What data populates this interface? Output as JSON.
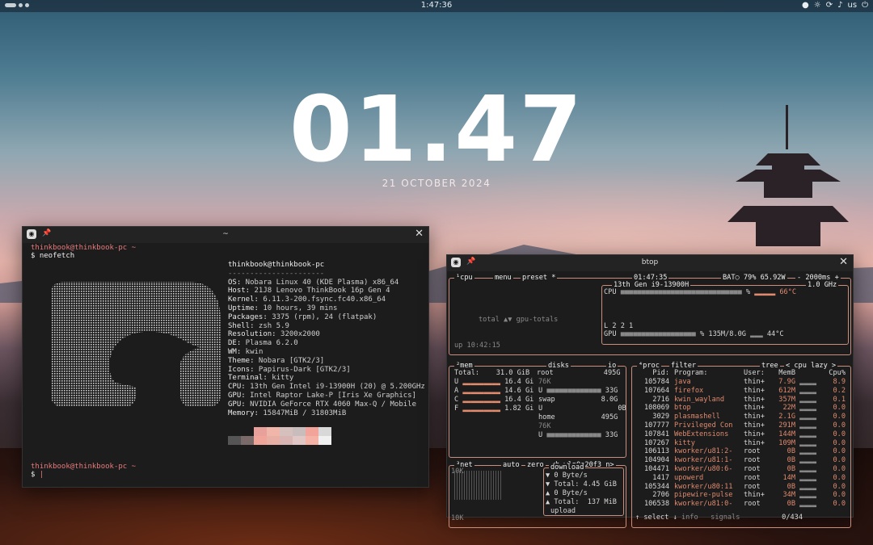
{
  "topbar": {
    "time": "1:47:36",
    "layout": "us"
  },
  "lockclock": {
    "time": "01.47",
    "date": "21 OCTOBER 2024"
  },
  "kitty": {
    "title": "~",
    "prompt1": "thinkbook@thinkbook-pc ~",
    "cmd": "$ neofetch",
    "prompt2": "thinkbook@thinkbook-pc ~",
    "cursor": "$ ",
    "header": "thinkbook@thinkbook-pc",
    "sep": "----------------------",
    "info": [
      {
        "k": "OS:",
        "v": " Nobara Linux 40 (KDE Plasma) x86_64"
      },
      {
        "k": "Host:",
        "v": " 21J8 Lenovo ThinkBook 16p Gen 4"
      },
      {
        "k": "Kernel:",
        "v": " 6.11.3-200.fsync.fc40.x86_64"
      },
      {
        "k": "Uptime:",
        "v": " 10 hours, 39 mins"
      },
      {
        "k": "Packages:",
        "v": " 3375 (rpm), 24 (flatpak)"
      },
      {
        "k": "Shell:",
        "v": " zsh 5.9"
      },
      {
        "k": "Resolution:",
        "v": " 3200x2000"
      },
      {
        "k": "DE:",
        "v": " Plasma 6.2.0"
      },
      {
        "k": "WM:",
        "v": " kwin"
      },
      {
        "k": "Theme:",
        "v": " Nobara [GTK2/3]"
      },
      {
        "k": "Icons:",
        "v": " Papirus-Dark [GTK2/3]"
      },
      {
        "k": "Terminal:",
        "v": " kitty"
      },
      {
        "k": "CPU:",
        "v": " 13th Gen Intel i9-13900H (20) @ 5.200GHz"
      },
      {
        "k": "GPU:",
        "v": " Intel Raptor Lake-P [Iris Xe Graphics]"
      },
      {
        "k": "GPU:",
        "v": " NVIDIA GeForce RTX 4060 Max-Q / Mobile"
      },
      {
        "k": "Memory:",
        "v": " 15847MiB / 31803MiB"
      }
    ],
    "palette_top": [
      "#1c1c1c",
      "#1c1c1c",
      "#e8a09a",
      "#f0b6a9",
      "#d6c0be",
      "#c9bcbc",
      "#f2a49a",
      "#d8d8d8"
    ],
    "palette_bot": [
      "#555",
      "#7a6a6a",
      "#f0a59a",
      "#e8b0a5",
      "#d8b5b2",
      "#e0c6c4",
      "#f5b3a8",
      "#f0f0f0"
    ]
  },
  "btop": {
    "title": "btop",
    "cpu_label": "¹cpu",
    "menu": "menu",
    "preset": "preset *",
    "clock": "01:47:35",
    "bat": "BAT○ 79% 65.92W",
    "rate": "- 2000ms +",
    "cpu_model": "13th Gen i9-13900H",
    "freq": "1.0 GHz",
    "cpu_row": "CPU",
    "cpu_pct": "%",
    "cpu_temp": "66°C",
    "load": "L 2 2 1",
    "gpu_row": "GPU",
    "gpu_pct": "%",
    "gpu_mem": "135M/8.0G",
    "gpu_temp": "44°C",
    "totals": "total ▲▼ gpu-totals",
    "uptime": "up 10:42:15",
    "mem": {
      "label": "²mem",
      "disks": "disks",
      "io": "io",
      "total": "Total:    31.0 GiB",
      "rows": [
        {
          "k": "U",
          "v": "16.4 Gi"
        },
        {
          "k": "A",
          "v": "14.6 Gi"
        },
        {
          "k": "C",
          "v": "16.4 Gi"
        },
        {
          "k": "F",
          "v": "1.82 Gi"
        }
      ],
      "root": "root",
      "root_size": "495G",
      "root_pct": "76K",
      "root_u": "U",
      "root_used": "33G",
      "swap": "swap",
      "swap_size": "8.0G",
      "swap_u": "U",
      "swap_used": "0B",
      "home": "home",
      "home_size": "495G",
      "home_pct": "76K",
      "home_u": "U",
      "home_used": "33G"
    },
    "net": {
      "label": "³net",
      "auto": "auto",
      "zero": "zero",
      "iface": "<b wlp0s20f3 n>",
      "scale_top": "10K",
      "scale_bot": "10K",
      "download": "download",
      "dl_rate": "▼ 0 Byte/s",
      "dl_total": "▼ Total: 4.45 GiB",
      "ul_rate": "▲ 0 Byte/s",
      "ul_total": "▲ Total:  137 MiB",
      "upload": "upload"
    },
    "proc": {
      "label": "⁴proc",
      "filter": "filter",
      "tree": "tree",
      "sort": "< cpu lazy >",
      "headers": {
        "pid": "Pid:",
        "prog": "Program:",
        "user": "User:",
        "mem": "MemB",
        "cpu": "Cpu%"
      },
      "rows": [
        {
          "pid": "105784",
          "prog": "java",
          "user": "thin+",
          "mem": "7.9G",
          "cpu": "8.9"
        },
        {
          "pid": "107664",
          "prog": "firefox",
          "user": "thin+",
          "mem": "612M",
          "cpu": "0.2"
        },
        {
          "pid": "2716",
          "prog": "kwin_wayland",
          "user": "thin+",
          "mem": "357M",
          "cpu": "0.1"
        },
        {
          "pid": "108069",
          "prog": "btop",
          "user": "thin+",
          "mem": "22M",
          "cpu": "0.0"
        },
        {
          "pid": "3029",
          "prog": "plasmashell",
          "user": "thin+",
          "mem": "2.1G",
          "cpu": "0.0"
        },
        {
          "pid": "107777",
          "prog": "Privileged Con",
          "user": "thin+",
          "mem": "291M",
          "cpu": "0.0"
        },
        {
          "pid": "107841",
          "prog": "WebExtensions",
          "user": "thin+",
          "mem": "144M",
          "cpu": "0.0"
        },
        {
          "pid": "107267",
          "prog": "kitty",
          "user": "thin+",
          "mem": "109M",
          "cpu": "0.0"
        },
        {
          "pid": "106113",
          "prog": "kworker/u81:2-",
          "user": "root",
          "mem": "0B",
          "cpu": "0.0"
        },
        {
          "pid": "104904",
          "prog": "kworker/u81:1-",
          "user": "root",
          "mem": "0B",
          "cpu": "0.0"
        },
        {
          "pid": "104471",
          "prog": "kworker/u80:6-",
          "user": "root",
          "mem": "0B",
          "cpu": "0.0"
        },
        {
          "pid": "1417",
          "prog": "upowerd",
          "user": "root",
          "mem": "14M",
          "cpu": "0.0"
        },
        {
          "pid": "105344",
          "prog": "kworker/u80:11",
          "user": "root",
          "mem": "0B",
          "cpu": "0.0"
        },
        {
          "pid": "2706",
          "prog": "pipewire-pulse",
          "user": "thin+",
          "mem": "34M",
          "cpu": "0.0"
        },
        {
          "pid": "106538",
          "prog": "kworker/u81:0-",
          "user": "root",
          "mem": "0B",
          "cpu": "0.0"
        }
      ],
      "select": "↑ select ↓",
      "info": "info",
      "signals": "signals",
      "count": "0/434"
    }
  }
}
